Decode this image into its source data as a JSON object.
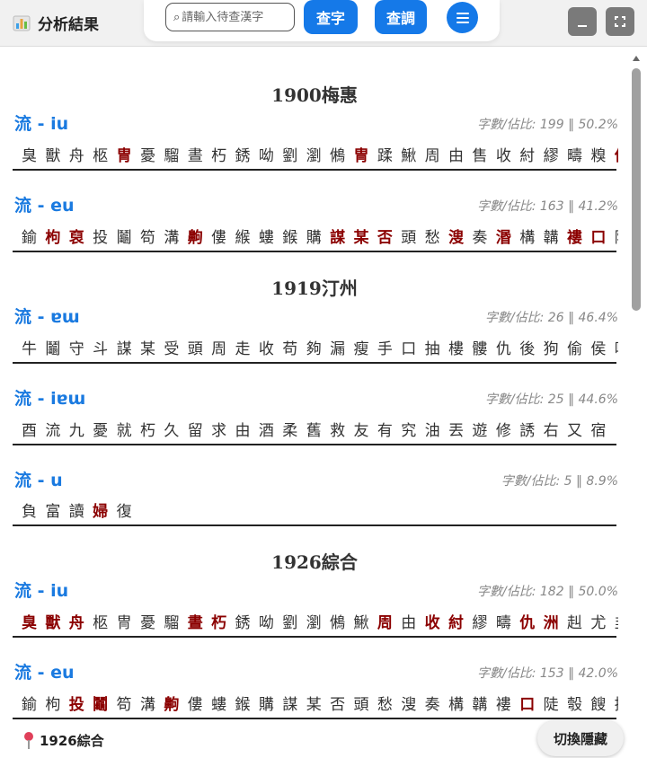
{
  "header": {
    "title": "分析結果",
    "icon": "bar-chart-icon",
    "search_placeholder": "請輸入待查漢字",
    "query_button": "查字",
    "lookup_button": "查調"
  },
  "colors": {
    "accent": "#1579e8",
    "highlight": "#8b0000",
    "heading": "#1a7ae0"
  },
  "sections": [
    {
      "location": "1900梅惠",
      "groups": [
        {
          "rhyme": "流 - iu",
          "stat": "字數/佔比: 199 ‖ 50.2%",
          "chars": [
            "臭",
            "獸",
            "舟",
            "柩",
            "冑",
            "憂",
            "騮",
            "晝",
            "朽",
            "銹",
            "呦",
            "劉",
            "瀏",
            "鵂",
            "冑",
            "蹂",
            "鰍",
            "周",
            "由",
            "售",
            "收",
            "紂",
            "繆",
            "疇",
            "糗",
            "仇"
          ],
          "hl": [
            4,
            14,
            25
          ]
        },
        {
          "rhyme": "流 - eu",
          "stat": "字數/佔比: 163 ‖ 41.2%",
          "chars": [
            "鍮",
            "枸",
            "裒",
            "投",
            "鬮",
            "笱",
            "溝",
            "齁",
            "僂",
            "緱",
            "螻",
            "鍭",
            "購",
            "謀",
            "某",
            "否",
            "頭",
            "愁",
            "溲",
            "奏",
            "湣",
            "構",
            "韝",
            "褸",
            "口",
            "陋"
          ],
          "hl": [
            1,
            2,
            7,
            13,
            14,
            15,
            18,
            20,
            23,
            24
          ]
        }
      ]
    },
    {
      "location": "1919汀州",
      "groups": [
        {
          "rhyme": "流 - ɐɯ",
          "stat": "字數/佔比: 26 ‖ 46.4%",
          "chars": [
            "牛",
            "鬮",
            "守",
            "斗",
            "謀",
            "某",
            "受",
            "頭",
            "周",
            "走",
            "收",
            "苟",
            "夠",
            "漏",
            "瘦",
            "手",
            "口",
            "抽",
            "樓",
            "髏",
            "仇",
            "後",
            "狗",
            "偷",
            "侯",
            "吼"
          ],
          "hl": []
        },
        {
          "rhyme": "流 - iɐɯ",
          "stat": "字數/佔比: 25 ‖ 44.6%",
          "chars": [
            "酉",
            "流",
            "九",
            "憂",
            "就",
            "朽",
            "久",
            "留",
            "求",
            "由",
            "酒",
            "柔",
            "舊",
            "救",
            "友",
            "有",
            "究",
            "油",
            "丟",
            "遊",
            "修",
            "誘",
            "右",
            "又",
            "宿"
          ],
          "hl": []
        },
        {
          "rhyme": "流 - u",
          "stat": "字數/佔比: 5 ‖ 8.9%",
          "chars": [
            "負",
            "富",
            "讀",
            "婦",
            "復"
          ],
          "hl": [
            3
          ]
        }
      ]
    },
    {
      "location": "1926綜合",
      "groups": [
        {
          "rhyme": "流 - iu",
          "stat": "字數/佔比: 182 ‖ 50.0%",
          "chars": [
            "臭",
            "獸",
            "舟",
            "柩",
            "冑",
            "憂",
            "騮",
            "晝",
            "朽",
            "銹",
            "呦",
            "劉",
            "瀏",
            "鵂",
            "鰍",
            "周",
            "由",
            "收",
            "紂",
            "繆",
            "疇",
            "仇",
            "洲",
            "赳",
            "尤",
            "韭"
          ],
          "hl": [
            0,
            1,
            2,
            7,
            8,
            15,
            17,
            18,
            21,
            22
          ]
        },
        {
          "rhyme": "流 - eu",
          "stat": "字數/佔比: 153 ‖ 42.0%",
          "chars": [
            "鍮",
            "枸",
            "投",
            "鬮",
            "笱",
            "溝",
            "齁",
            "僂",
            "螻",
            "鍭",
            "購",
            "謀",
            "某",
            "否",
            "頭",
            "愁",
            "溲",
            "奏",
            "構",
            "韝",
            "褸",
            "口",
            "陡",
            "彀",
            "餿",
            "掬"
          ],
          "hl": [
            2,
            3,
            6,
            21
          ]
        }
      ]
    }
  ],
  "footer": {
    "location": "1926綜合",
    "toggle_button": "切換隱藏"
  }
}
